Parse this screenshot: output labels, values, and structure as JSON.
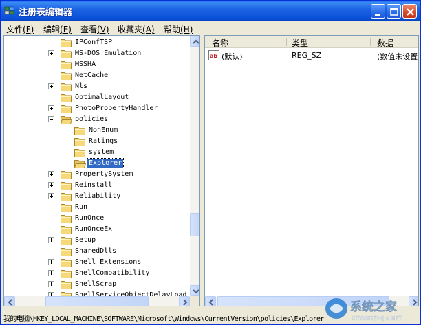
{
  "window": {
    "title": "注册表编辑器"
  },
  "menu": [
    {
      "label": "文件",
      "key": "(F)"
    },
    {
      "label": "编辑",
      "key": "(E)"
    },
    {
      "label": "查看",
      "key": "(V)"
    },
    {
      "label": "收藏夹",
      "key": "(A)"
    },
    {
      "label": "帮助",
      "key": "(H)"
    }
  ],
  "tree": {
    "items": [
      {
        "label": "IPConfTSP",
        "expandable": false,
        "level": 0
      },
      {
        "label": "MS-DOS Emulation",
        "expandable": true,
        "level": 0
      },
      {
        "label": "MSSHA",
        "expandable": false,
        "level": 0
      },
      {
        "label": "NetCache",
        "expandable": false,
        "level": 0
      },
      {
        "label": "Nls",
        "expandable": true,
        "level": 0
      },
      {
        "label": "OptimalLayout",
        "expandable": false,
        "level": 0
      },
      {
        "label": "PhotoPropertyHandler",
        "expandable": true,
        "level": 0
      },
      {
        "label": "policies",
        "expandable": true,
        "expanded": true,
        "level": 0
      },
      {
        "label": "NonEnum",
        "expandable": false,
        "level": 1
      },
      {
        "label": "Ratings",
        "expandable": false,
        "level": 1
      },
      {
        "label": "system",
        "expandable": false,
        "level": 1
      },
      {
        "label": "Explorer",
        "expandable": false,
        "level": 1,
        "selected": true
      },
      {
        "label": "PropertySystem",
        "expandable": true,
        "level": 0
      },
      {
        "label": "Reinstall",
        "expandable": true,
        "level": 0
      },
      {
        "label": "Reliability",
        "expandable": true,
        "level": 0
      },
      {
        "label": "Run",
        "expandable": false,
        "level": 0
      },
      {
        "label": "RunOnce",
        "expandable": false,
        "level": 0
      },
      {
        "label": "RunOnceEx",
        "expandable": false,
        "level": 0
      },
      {
        "label": "Setup",
        "expandable": true,
        "level": 0
      },
      {
        "label": "SharedDlls",
        "expandable": false,
        "level": 0
      },
      {
        "label": "Shell Extensions",
        "expandable": true,
        "level": 0
      },
      {
        "label": "ShellCompatibility",
        "expandable": true,
        "level": 0
      },
      {
        "label": "ShellScrap",
        "expandable": true,
        "level": 0
      },
      {
        "label": "ShellServiceObjectDelayLoad",
        "expandable": true,
        "level": 0
      }
    ]
  },
  "list": {
    "columns": [
      "名称",
      "类型",
      "数据"
    ],
    "rows": [
      {
        "icon": "reg-sz-icon",
        "name": "(默认)",
        "type": "REG_SZ",
        "data": "(数值未设置"
      }
    ]
  },
  "status": {
    "path": "我的电脑\\HKEY_LOCAL_MACHINE\\SOFTWARE\\Microsoft\\Windows\\CurrentVersion\\policies\\Explorer"
  },
  "watermark": {
    "text": "系统之家",
    "subtext": "XITONGZHIJIA.NET"
  },
  "colors": {
    "titlebar": "#0a50d8",
    "selection": "#316ac5",
    "folder": "#f5d97a"
  }
}
